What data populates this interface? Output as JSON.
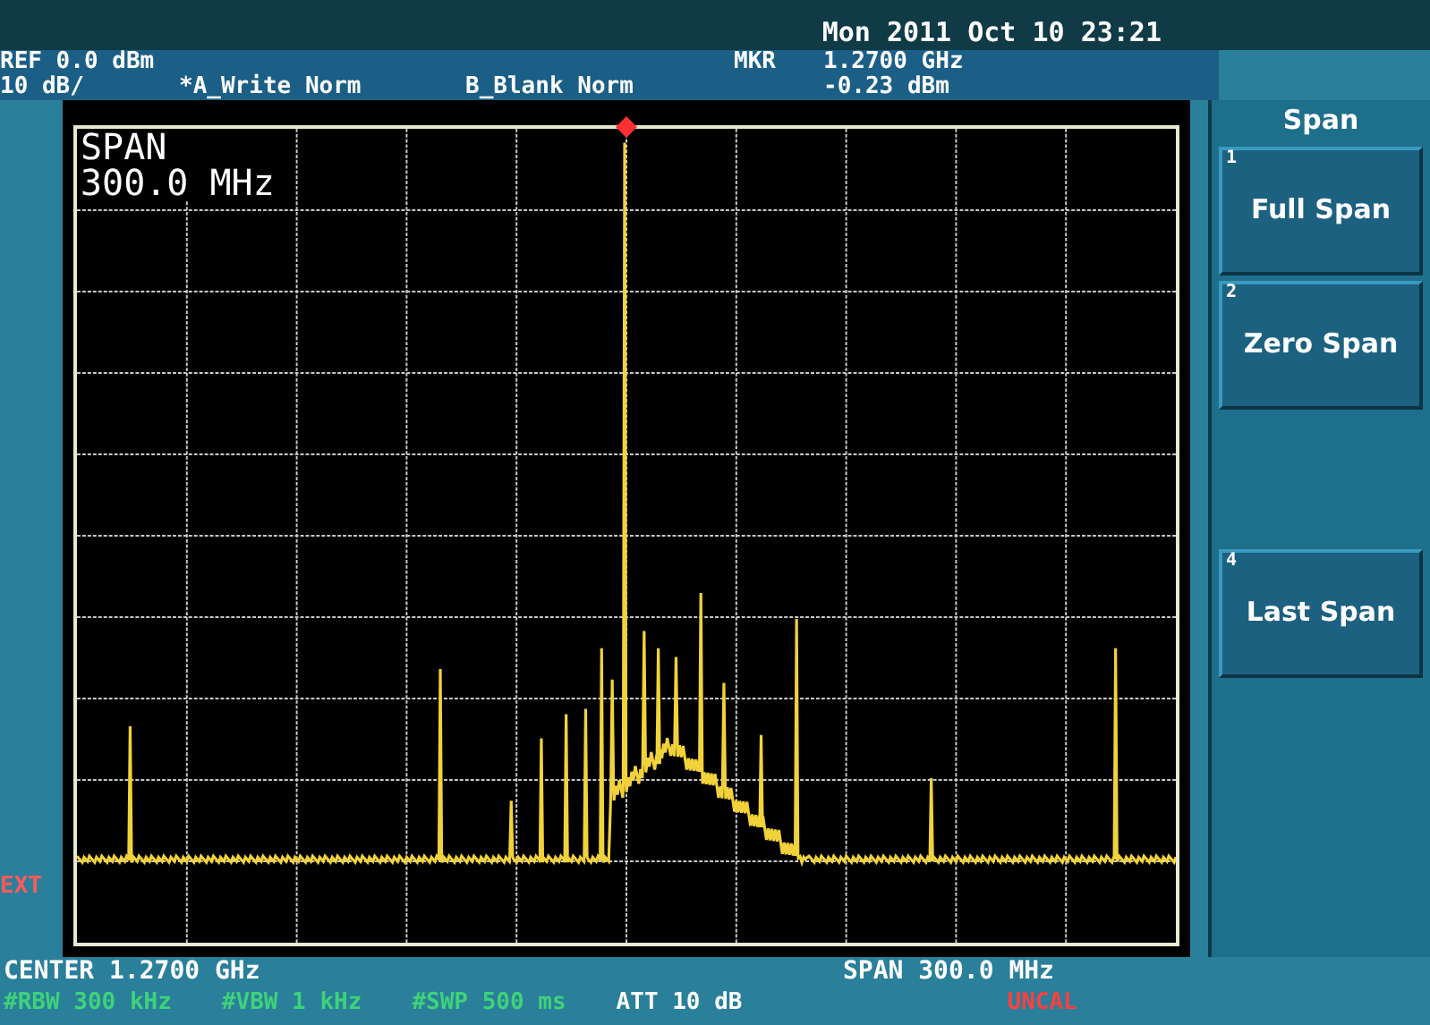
{
  "datetime": "Mon 2011 Oct 10 23:21",
  "header": {
    "ref": "REF 0.0 dBm",
    "scale": "10 dB/",
    "trace_a": "*A_Write Norm",
    "trace_b": "B_Blank Norm",
    "marker_label": "MKR",
    "marker_freq": "1.2700 GHz",
    "marker_level": "-0.23 dBm"
  },
  "plot": {
    "span_label": "SPAN",
    "span_value": "300.0 MHz"
  },
  "ext_label": "EXT",
  "softkeys": {
    "title": "Span",
    "keys": [
      {
        "kind": "key",
        "number": "1",
        "label": "Full Span"
      },
      {
        "kind": "key",
        "number": "2",
        "label": "Zero Span"
      },
      {
        "kind": "blank"
      },
      {
        "kind": "key",
        "number": "4",
        "label": "Last Span"
      }
    ]
  },
  "footer": {
    "center": "CENTER 1.2700 GHz",
    "span": "SPAN 300.0 MHz",
    "rbw": "#RBW 300 kHz",
    "vbw": "#VBW 1 kHz",
    "swp": "#SWP 500 ms",
    "att": "ATT 10 dB",
    "uncal": "UNCAL"
  }
}
